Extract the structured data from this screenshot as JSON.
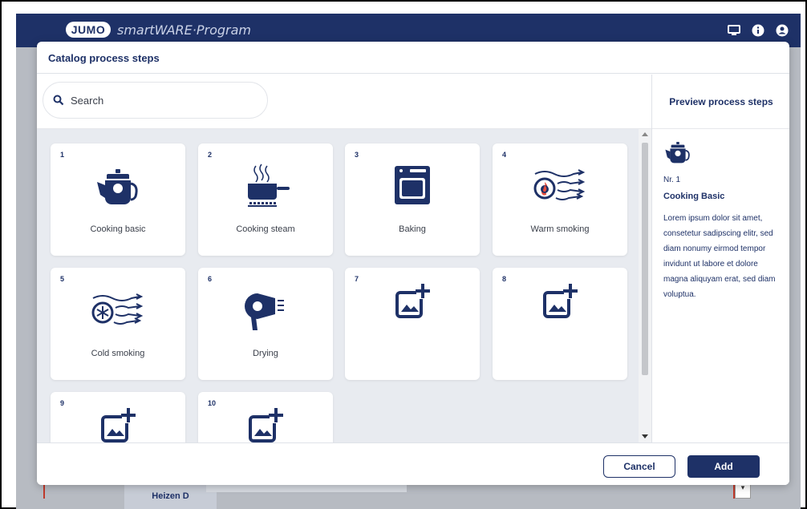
{
  "app": {
    "logo_text": "JUMO",
    "brand_text": "smartWARE·Program",
    "background_row_label": "Heizen D",
    "icons": [
      "monitor-icon",
      "info-icon",
      "user-icon"
    ]
  },
  "modal": {
    "title": "Catalog process steps",
    "search": {
      "placeholder": "Search",
      "value": ""
    },
    "cards": [
      {
        "num": "1",
        "label": "Cooking basic",
        "icon": "kettle-icon"
      },
      {
        "num": "2",
        "label": "Cooking steam",
        "icon": "steam-pot-icon"
      },
      {
        "num": "3",
        "label": "Baking",
        "icon": "oven-icon"
      },
      {
        "num": "4",
        "label": "Warm smoking",
        "icon": "warm-smoking-icon"
      },
      {
        "num": "5",
        "label": "Cold smoking",
        "icon": "cold-smoking-icon"
      },
      {
        "num": "6",
        "label": "Drying",
        "icon": "hair-dryer-icon"
      },
      {
        "num": "7",
        "label": "",
        "icon": "add-image-icon"
      },
      {
        "num": "8",
        "label": "",
        "icon": "add-image-icon"
      },
      {
        "num": "9",
        "label": "",
        "icon": "add-image-icon"
      },
      {
        "num": "10",
        "label": "",
        "icon": "add-image-icon"
      }
    ],
    "preview": {
      "title": "Preview process steps",
      "nr": "Nr. 1",
      "name": "Cooking Basic",
      "description": "Lorem ipsum dolor sit amet, consetetur sadipscing elitr, sed diam nonumy eirmod tempor invidunt ut labore et dolore magna aliquyam erat, sed diam voluptua."
    },
    "buttons": {
      "cancel": "Cancel",
      "add": "Add"
    }
  },
  "colors": {
    "primary": "#1e3167",
    "grid_bg": "#e8ebf0",
    "overlay": "#b7bbc2"
  }
}
